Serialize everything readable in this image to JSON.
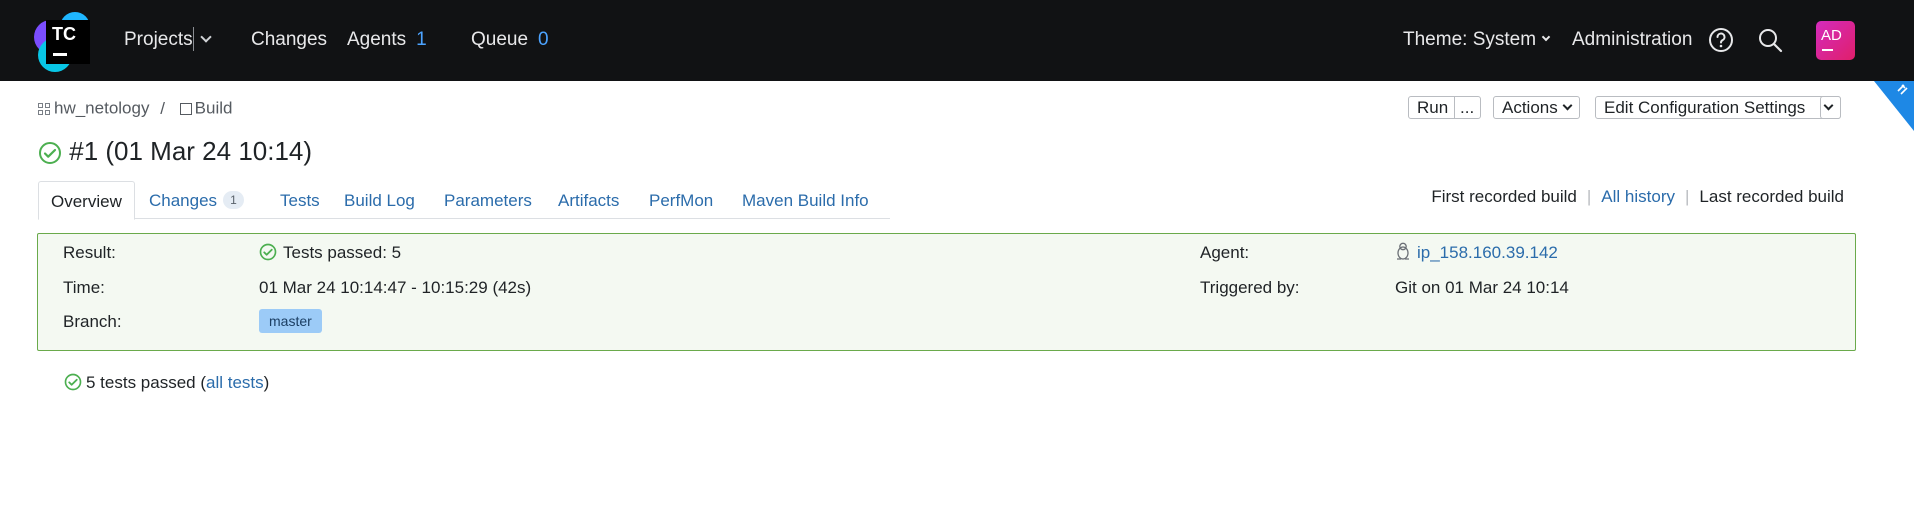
{
  "header": {
    "logo_text": "TC",
    "projects_label": "Projects",
    "changes_label": "Changes",
    "agents_label": "Agents",
    "agents_count": "1",
    "queue_label": "Queue",
    "queue_count": "0",
    "theme_label": "Theme: System",
    "administration_label": "Administration",
    "avatar_initials": "AD"
  },
  "breadcrumb": {
    "project": "hw_netology",
    "separator": "/",
    "build_config": "Build"
  },
  "toolbar": {
    "run_label": "Run",
    "run_more_label": "...",
    "actions_label": "Actions",
    "edit_settings_label": "Edit Configuration Settings"
  },
  "build": {
    "title": "#1 (01 Mar 24 10:14)",
    "status": "success"
  },
  "tabs": [
    {
      "label": "Overview",
      "active": true
    },
    {
      "label": "Changes",
      "badge": "1"
    },
    {
      "label": "Tests"
    },
    {
      "label": "Build Log"
    },
    {
      "label": "Parameters"
    },
    {
      "label": "Artifacts"
    },
    {
      "label": "PerfMon"
    },
    {
      "label": "Maven Build Info"
    }
  ],
  "history": {
    "first": "First recorded build",
    "all": "All history",
    "last": "Last recorded build"
  },
  "details": {
    "result_label": "Result:",
    "result_value": "Tests passed: 5",
    "time_label": "Time:",
    "time_value": "01 Mar 24 10:14:47 - 10:15:29 (42s)",
    "branch_label": "Branch:",
    "branch_value": "master",
    "agent_label": "Agent:",
    "agent_value": "ip_158.160.39.142",
    "triggered_label": "Triggered by:",
    "triggered_value": "Git on 01 Mar 24 10:14"
  },
  "summary": {
    "text": "5 tests passed (",
    "link": "all tests",
    "close": ")"
  },
  "colors": {
    "header_bg": "#111214",
    "accent_count": "#4ca3ff",
    "link": "#2b6cab",
    "success_green": "#4caf50",
    "panel_bg": "#f4f9f2",
    "panel_border": "#6aaa4b",
    "branch_bg": "#9ccbf7"
  }
}
